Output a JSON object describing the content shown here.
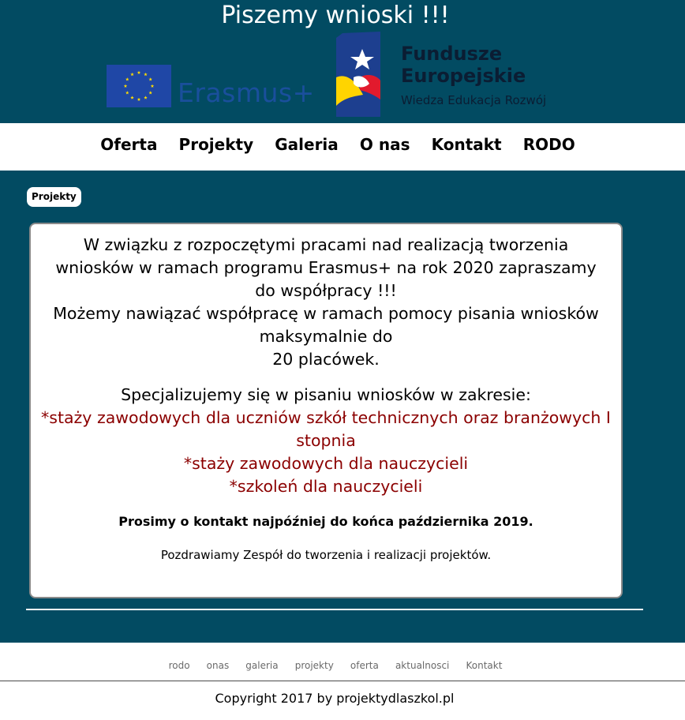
{
  "header": {
    "title": "Piszemy wnioski !!!",
    "logos": {
      "erasmus": {
        "text": "Erasmus+",
        "icon": "eu-flag-icon",
        "flag_color": "#1f47a6",
        "star_color": "#ffdd00",
        "text_color": "#1a4f9c"
      },
      "fundusze": {
        "name_line1": "Fundusze",
        "name_line2": "Europejskie",
        "tagline": "Wiedza Edukacja Rozwój",
        "icon": "fundusze-emblem-icon"
      }
    }
  },
  "nav": {
    "items": [
      "Oferta",
      "Projekty",
      "Galeria",
      "O nas",
      "Kontakt",
      "RODO"
    ]
  },
  "main": {
    "badge": "Projekty",
    "lead_lines": [
      "W związku z rozpoczętymi pracami nad realizacją tworzenia wniosków w ramach programu Erasmus+ na rok 2020 zapraszamy do współpracy !!!",
      "Możemy nawiązać współpracę w ramach pomocy pisania wniosków maksymalnie do",
      "20 placówek."
    ],
    "spec_heading": "Specjalizujemy się w pisaniu wniosków w zakresie:",
    "spec_items": [
      "*staży zawodowych dla uczniów szkół technicznych oraz branżowych I stopnia",
      "*staży zawodowych dla nauczycieli",
      "*szkoleń dla nauczycieli"
    ],
    "deadline": "Prosimy o kontakt najpóźniej do końca października 2019.",
    "greeting": "Pozdrawiamy Zespół do tworzenia i realizacji projektów."
  },
  "footer": {
    "links": [
      "rodo",
      "onas",
      "galeria",
      "projekty",
      "oferta",
      "aktualnosci",
      "Kontakt"
    ],
    "copyright": "Copyright 2017 by projektydlaszkol.pl"
  },
  "colors": {
    "header_bg": "#024b62",
    "accent_red": "#8b0000",
    "footer_link": "#6a6a6a"
  }
}
